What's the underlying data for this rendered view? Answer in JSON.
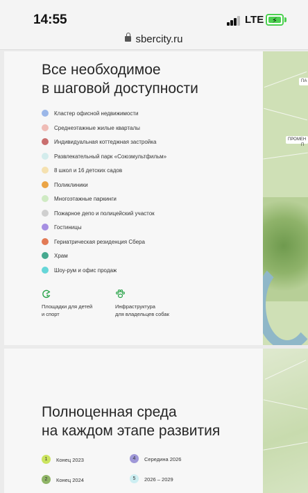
{
  "status_bar": {
    "time": "14:55",
    "network": "LTE"
  },
  "browser": {
    "url": "sbercity.ru"
  },
  "section1": {
    "title_line1": "Все необходимое",
    "title_line2": "в шаговой доступности",
    "legend": [
      {
        "label": "Кластер офисной недвижимости",
        "color": "#9bb7e8"
      },
      {
        "label": "Среднеэтажные жилые кварталы",
        "color": "#efbcb6"
      },
      {
        "label": "Индивидуальная коттеджная застройка",
        "color": "#c96e6e"
      },
      {
        "label": "Развлекательный парк «Союзмультфильм»",
        "color": "#d3ecec"
      },
      {
        "label": "8 школ и 16 детских садов",
        "color": "#f5e1b0"
      },
      {
        "label": "Поликлиники",
        "color": "#eba445"
      },
      {
        "label": "Многоэтажные паркинги",
        "color": "#cfeac3"
      },
      {
        "label": "Пожарное депо и полицейский участок",
        "color": "#cfcfcf"
      },
      {
        "label": "Гостиницы",
        "color": "#a68fe2"
      },
      {
        "label": "Гериатрическая резиденция Сбера",
        "color": "#e27a55"
      },
      {
        "label": "Храм",
        "color": "#46a98f"
      },
      {
        "label": "Шоу-рум и офис продаж",
        "color": "#66d6d8"
      }
    ],
    "amenities": [
      {
        "line1": "Площадки для детей",
        "line2": "и спорт",
        "icon": "playground-icon"
      },
      {
        "line1": "Инфраструктура",
        "line2": "для владельцев собак",
        "icon": "paw-icon"
      }
    ],
    "map_labels": [
      "ПА",
      "ПРОМЕН",
      "П"
    ],
    "accent_color": "#2aa44a"
  },
  "section2": {
    "title_line1": "Полноценная среда",
    "title_line2": "на каждом этапе развития",
    "stages": [
      {
        "num": "1",
        "label": "Конец 2023",
        "color": "#cbe45f"
      },
      {
        "num": "2",
        "label": "Конец 2024",
        "color": "#8fb466"
      },
      {
        "num": "4",
        "label": "Середина 2026",
        "color": "#9f98d8"
      },
      {
        "num": "5",
        "label": "2026 – 2029",
        "color": "#cdeef2"
      }
    ]
  }
}
